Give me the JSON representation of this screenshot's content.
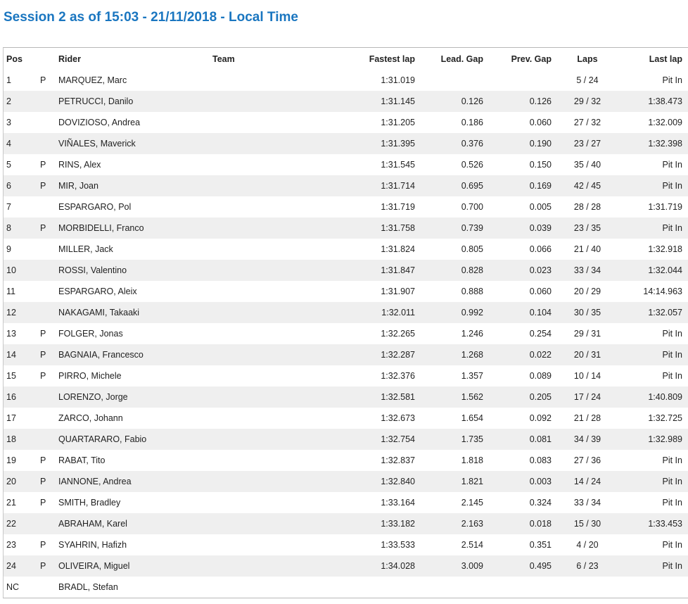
{
  "page": {
    "title": "Session 2 as of 15:03 - 21/11/2018 - Local Time"
  },
  "table": {
    "headers": {
      "pos": "Pos",
      "rider": "Rider",
      "team": "Team",
      "fastest_lap": "Fastest lap",
      "lead_gap": "Lead. Gap",
      "prev_gap": "Prev. Gap",
      "laps": "Laps",
      "last_lap": "Last lap"
    },
    "rows": [
      {
        "pos": "1",
        "flag": "P",
        "rider": "MARQUEZ, Marc",
        "team": "",
        "fastest": "1:31.019",
        "lead": "",
        "prev": "",
        "laps": "5 / 24",
        "last": "Pit In"
      },
      {
        "pos": "2",
        "flag": "",
        "rider": "PETRUCCI, Danilo",
        "team": "",
        "fastest": "1:31.145",
        "lead": "0.126",
        "prev": "0.126",
        "laps": "29 / 32",
        "last": "1:38.473"
      },
      {
        "pos": "3",
        "flag": "",
        "rider": "DOVIZIOSO, Andrea",
        "team": "",
        "fastest": "1:31.205",
        "lead": "0.186",
        "prev": "0.060",
        "laps": "27 / 32",
        "last": "1:32.009"
      },
      {
        "pos": "4",
        "flag": "",
        "rider": "VIÑALES, Maverick",
        "team": "",
        "fastest": "1:31.395",
        "lead": "0.376",
        "prev": "0.190",
        "laps": "23 / 27",
        "last": "1:32.398"
      },
      {
        "pos": "5",
        "flag": "P",
        "rider": "RINS, Alex",
        "team": "",
        "fastest": "1:31.545",
        "lead": "0.526",
        "prev": "0.150",
        "laps": "35 / 40",
        "last": "Pit In"
      },
      {
        "pos": "6",
        "flag": "P",
        "rider": "MIR, Joan",
        "team": "",
        "fastest": "1:31.714",
        "lead": "0.695",
        "prev": "0.169",
        "laps": "42 / 45",
        "last": "Pit In"
      },
      {
        "pos": "7",
        "flag": "",
        "rider": "ESPARGARO, Pol",
        "team": "",
        "fastest": "1:31.719",
        "lead": "0.700",
        "prev": "0.005",
        "laps": "28 / 28",
        "last": "1:31.719"
      },
      {
        "pos": "8",
        "flag": "P",
        "rider": "MORBIDELLI, Franco",
        "team": "",
        "fastest": "1:31.758",
        "lead": "0.739",
        "prev": "0.039",
        "laps": "23 / 35",
        "last": "Pit In"
      },
      {
        "pos": "9",
        "flag": "",
        "rider": "MILLER, Jack",
        "team": "",
        "fastest": "1:31.824",
        "lead": "0.805",
        "prev": "0.066",
        "laps": "21 / 40",
        "last": "1:32.918"
      },
      {
        "pos": "10",
        "flag": "",
        "rider": "ROSSI, Valentino",
        "team": "",
        "fastest": "1:31.847",
        "lead": "0.828",
        "prev": "0.023",
        "laps": "33 / 34",
        "last": "1:32.044"
      },
      {
        "pos": "11",
        "flag": "",
        "rider": "ESPARGARO, Aleix",
        "team": "",
        "fastest": "1:31.907",
        "lead": "0.888",
        "prev": "0.060",
        "laps": "20 / 29",
        "last": "14:14.963"
      },
      {
        "pos": "12",
        "flag": "",
        "rider": "NAKAGAMI, Takaaki",
        "team": "",
        "fastest": "1:32.011",
        "lead": "0.992",
        "prev": "0.104",
        "laps": "30 / 35",
        "last": "1:32.057"
      },
      {
        "pos": "13",
        "flag": "P",
        "rider": "FOLGER, Jonas",
        "team": "",
        "fastest": "1:32.265",
        "lead": "1.246",
        "prev": "0.254",
        "laps": "29 / 31",
        "last": "Pit In"
      },
      {
        "pos": "14",
        "flag": "P",
        "rider": "BAGNAIA, Francesco",
        "team": "",
        "fastest": "1:32.287",
        "lead": "1.268",
        "prev": "0.022",
        "laps": "20 / 31",
        "last": "Pit In"
      },
      {
        "pos": "15",
        "flag": "P",
        "rider": "PIRRO, Michele",
        "team": "",
        "fastest": "1:32.376",
        "lead": "1.357",
        "prev": "0.089",
        "laps": "10 / 14",
        "last": "Pit In"
      },
      {
        "pos": "16",
        "flag": "",
        "rider": "LORENZO, Jorge",
        "team": "",
        "fastest": "1:32.581",
        "lead": "1.562",
        "prev": "0.205",
        "laps": "17 / 24",
        "last": "1:40.809"
      },
      {
        "pos": "17",
        "flag": "",
        "rider": "ZARCO, Johann",
        "team": "",
        "fastest": "1:32.673",
        "lead": "1.654",
        "prev": "0.092",
        "laps": "21 / 28",
        "last": "1:32.725"
      },
      {
        "pos": "18",
        "flag": "",
        "rider": "QUARTARARO, Fabio",
        "team": "",
        "fastest": "1:32.754",
        "lead": "1.735",
        "prev": "0.081",
        "laps": "34 / 39",
        "last": "1:32.989"
      },
      {
        "pos": "19",
        "flag": "P",
        "rider": "RABAT, Tito",
        "team": "",
        "fastest": "1:32.837",
        "lead": "1.818",
        "prev": "0.083",
        "laps": "27 / 36",
        "last": "Pit In"
      },
      {
        "pos": "20",
        "flag": "P",
        "rider": "IANNONE, Andrea",
        "team": "",
        "fastest": "1:32.840",
        "lead": "1.821",
        "prev": "0.003",
        "laps": "14 / 24",
        "last": "Pit In"
      },
      {
        "pos": "21",
        "flag": "P",
        "rider": "SMITH, Bradley",
        "team": "",
        "fastest": "1:33.164",
        "lead": "2.145",
        "prev": "0.324",
        "laps": "33 / 34",
        "last": "Pit In"
      },
      {
        "pos": "22",
        "flag": "",
        "rider": "ABRAHAM, Karel",
        "team": "",
        "fastest": "1:33.182",
        "lead": "2.163",
        "prev": "0.018",
        "laps": "15 / 30",
        "last": "1:33.453"
      },
      {
        "pos": "23",
        "flag": "P",
        "rider": "SYAHRIN, Hafizh",
        "team": "",
        "fastest": "1:33.533",
        "lead": "2.514",
        "prev": "0.351",
        "laps": "4 / 20",
        "last": "Pit In"
      },
      {
        "pos": "24",
        "flag": "P",
        "rider": "OLIVEIRA, Miguel",
        "team": "",
        "fastest": "1:34.028",
        "lead": "3.009",
        "prev": "0.495",
        "laps": "6 / 23",
        "last": "Pit In"
      },
      {
        "pos": "NC",
        "flag": "",
        "rider": "BRADL, Stefan",
        "team": "",
        "fastest": "",
        "lead": "",
        "prev": "",
        "laps": "",
        "last": ""
      }
    ]
  }
}
